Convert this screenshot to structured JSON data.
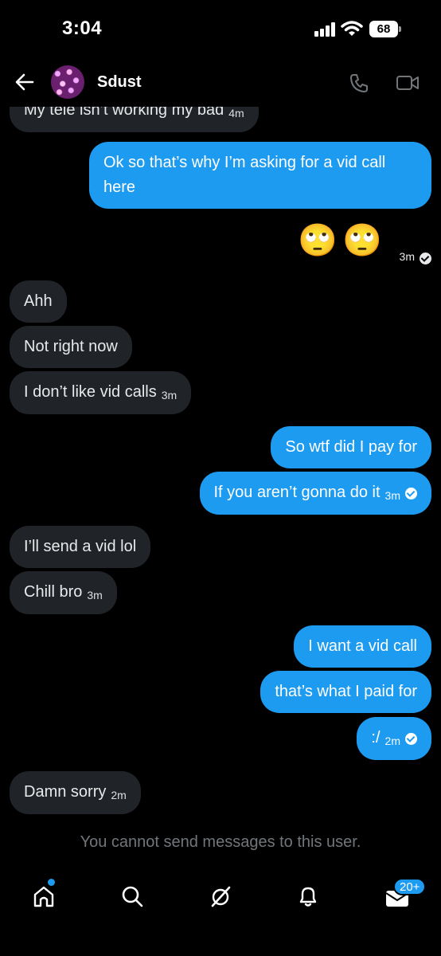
{
  "status_bar": {
    "time": "3:04",
    "battery": "68"
  },
  "header": {
    "name": "Sdust"
  },
  "messages": [
    {
      "side": "received",
      "text": "My tele isn’t working my bad",
      "time": "4m"
    },
    {
      "side": "sent",
      "text": "Ok so that’s why I’m asking for a vid call here"
    },
    {
      "side": "sent",
      "text": "🙄🙄",
      "time": "3m"
    },
    {
      "side": "received",
      "text": "Ahh"
    },
    {
      "side": "received",
      "text": "Not right now"
    },
    {
      "side": "received",
      "text": "I don’t like vid calls",
      "time": "3m"
    },
    {
      "side": "sent",
      "text": "So wtf did I pay for"
    },
    {
      "side": "sent",
      "text": "If you aren’t gonna do it",
      "time": "3m"
    },
    {
      "side": "received",
      "text": "I’ll send a vid lol"
    },
    {
      "side": "received",
      "text": "Chill bro",
      "time": "3m"
    },
    {
      "side": "sent",
      "text": "I want a vid call"
    },
    {
      "side": "sent",
      "text": "that’s what I paid for"
    },
    {
      "side": "sent",
      "text": ":/",
      "time": "2m"
    },
    {
      "side": "received",
      "text": "Damn sorry",
      "time": "2m"
    }
  ],
  "notice": "You cannot send messages to this user.",
  "nav": {
    "messages_badge": "20+"
  },
  "colors": {
    "sent_bubble": "#1d9bf0",
    "received_bubble": "#202327",
    "background": "#000000"
  }
}
